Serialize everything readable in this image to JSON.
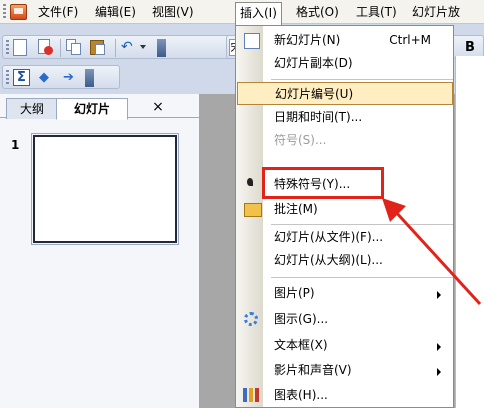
{
  "menubar": {
    "items": [
      {
        "label": "文件(F)"
      },
      {
        "label": "编辑(E)"
      },
      {
        "label": "视图(V)"
      },
      {
        "label": "插入(I)"
      },
      {
        "label": "格式(O)"
      },
      {
        "label": "工具(T)"
      },
      {
        "label": "幻灯片放"
      }
    ]
  },
  "toolbar": {
    "font_box": "宋",
    "bold": "B",
    "sum": "Σ"
  },
  "pane": {
    "tabs": [
      {
        "label": "大纲"
      },
      {
        "label": "幻灯片"
      }
    ],
    "close": "×",
    "slide_number": "1"
  },
  "dropdown": {
    "items": [
      {
        "label": "新幻灯片(N)",
        "shortcut": "Ctrl+M"
      },
      {
        "label": "幻灯片副本(D)"
      },
      {
        "label": "幻灯片编号(U)"
      },
      {
        "label": "日期和时间(T)..."
      },
      {
        "label": "符号(S)..."
      },
      {
        "label": "特殊符号(Y)..."
      },
      {
        "label": "批注(M)"
      },
      {
        "label": "幻灯片(从文件)(F)..."
      },
      {
        "label": "幻灯片(从大纲)(L)..."
      },
      {
        "label": "图片(P)"
      },
      {
        "label": "图示(G)..."
      },
      {
        "label": "文本框(X)"
      },
      {
        "label": "影片和声音(V)"
      },
      {
        "label": "图表(H)..."
      }
    ]
  },
  "colors": {
    "highlight": "#ffeec2",
    "annotation": "#e2231a"
  }
}
